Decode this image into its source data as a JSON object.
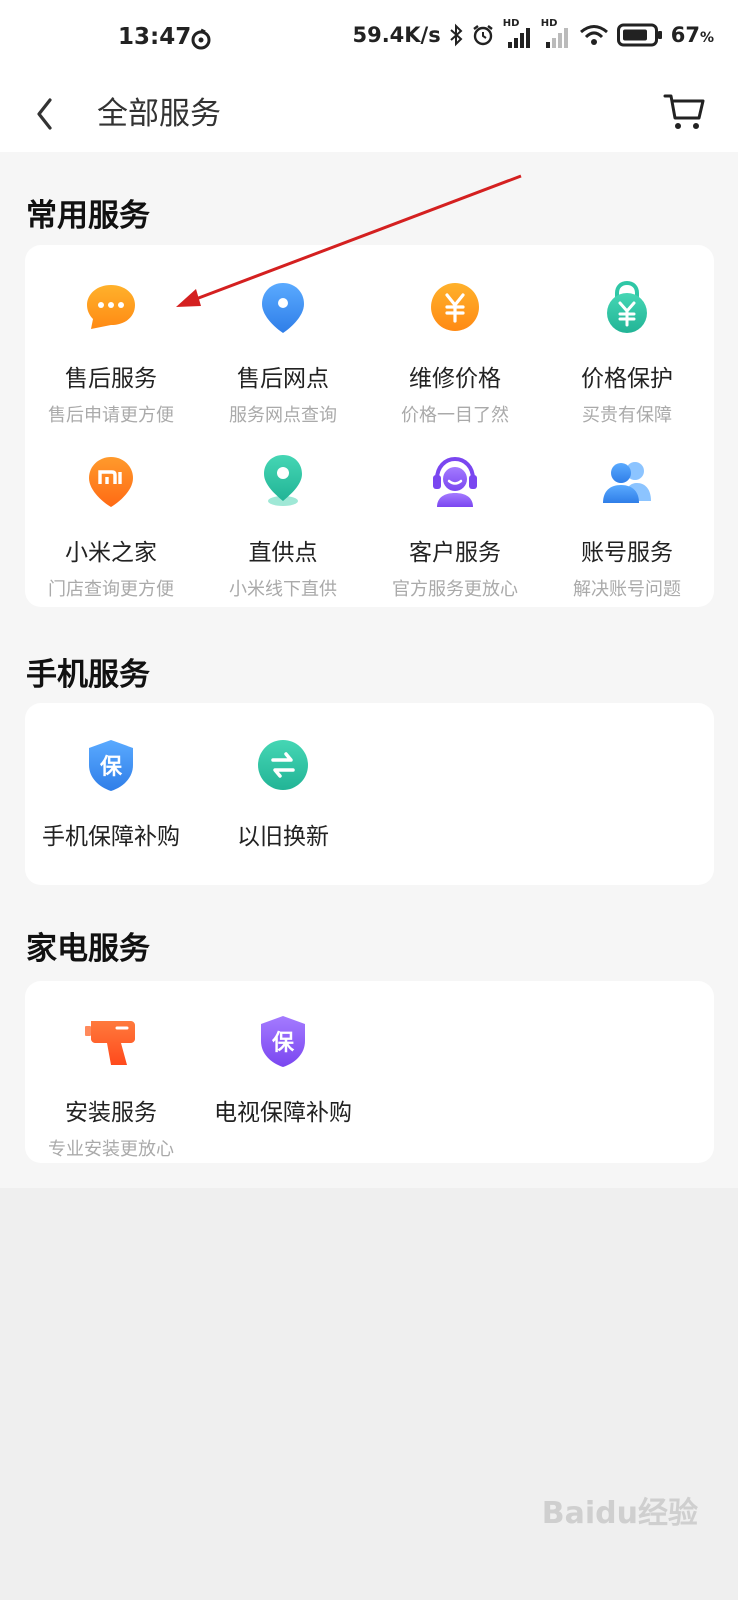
{
  "status_bar": {
    "time": "13:47",
    "network_speed": "59.4K/s",
    "battery_percent": "67",
    "battery_unit": "%",
    "hd1": "HD",
    "hd2": "HD"
  },
  "nav": {
    "title": "全部服务"
  },
  "sections": {
    "common": {
      "title": "常用服务",
      "items": [
        {
          "name": "售后服务",
          "desc": "售后申请更方便",
          "icon": "chat-bubble-icon",
          "color": "#ff9a1f"
        },
        {
          "name": "售后网点",
          "desc": "服务网点查询",
          "icon": "location-pin-icon",
          "color": "#3a8ef5"
        },
        {
          "name": "维修价格",
          "desc": "价格一目了然",
          "icon": "yuan-coin-icon",
          "color": "#ff9a1f",
          "glyph": "¥"
        },
        {
          "name": "价格保护",
          "desc": "买贵有保障",
          "icon": "price-lock-icon",
          "color": "#2fc7a6",
          "glyph": "¥"
        },
        {
          "name": "小米之家",
          "desc": "门店查询更方便",
          "icon": "mi-store-icon",
          "color": "#ff7a1a",
          "glyph": "MI"
        },
        {
          "name": "直供点",
          "desc": "小米线下直供",
          "icon": "map-marker-icon",
          "color": "#2fc7a6"
        },
        {
          "name": "客户服务",
          "desc": "官方服务更放心",
          "icon": "headset-agent-icon",
          "color": "#8b5cf6"
        },
        {
          "name": "账号服务",
          "desc": "解决账号问题",
          "icon": "users-icon",
          "color": "#3a8ef5"
        }
      ]
    },
    "phone": {
      "title": "手机服务",
      "items": [
        {
          "name": "手机保障补购",
          "desc": "",
          "icon": "shield-protect-icon",
          "color": "#3a8ef5",
          "glyph": "保"
        },
        {
          "name": "以旧换新",
          "desc": "",
          "icon": "trade-in-icon",
          "color": "#2fc7a6"
        }
      ]
    },
    "appliance": {
      "title": "家电服务",
      "items": [
        {
          "name": "安装服务",
          "desc": "专业安装更放心",
          "icon": "drill-icon",
          "color": "#ff5a2c"
        },
        {
          "name": "电视保障补购",
          "desc": "",
          "icon": "tv-shield-icon",
          "color": "#8b5cf6",
          "glyph": "保"
        }
      ]
    }
  },
  "watermark": "Baidu经验"
}
